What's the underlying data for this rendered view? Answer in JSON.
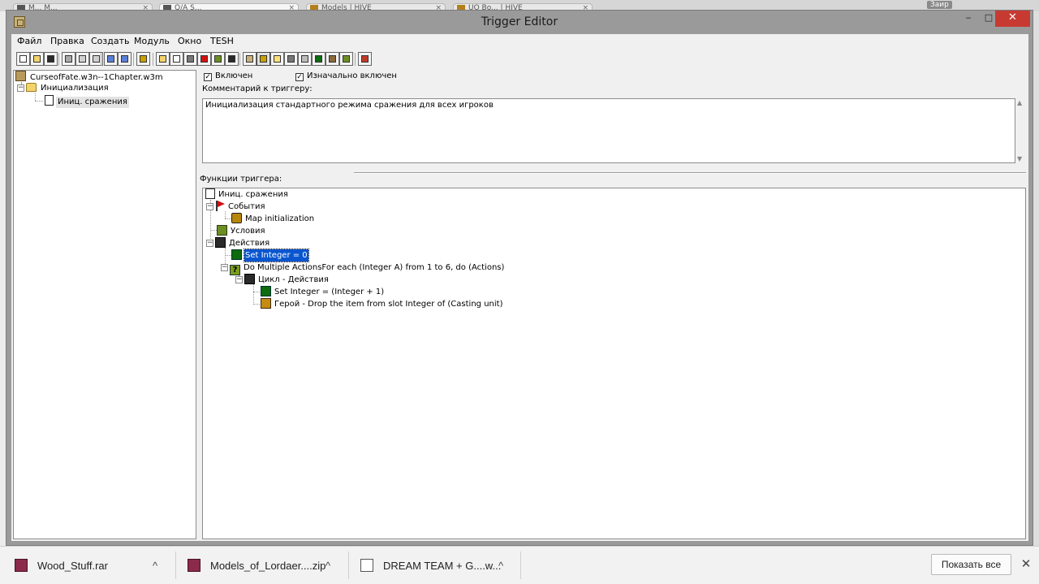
{
  "browser_tabs": [
    {
      "label": "M... M..."
    },
    {
      "label": "Q/A S..."
    },
    {
      "label": "Models | HIVE"
    },
    {
      "label": "UO Bo... | HIVE"
    }
  ],
  "user_chip": "Заир",
  "window": {
    "title": "Trigger Editor",
    "minimize": "‒",
    "maximize": "□",
    "close": "✕"
  },
  "menu": [
    {
      "label": "Файл"
    },
    {
      "label": "Правка"
    },
    {
      "label": "Создать"
    },
    {
      "label": "Модуль"
    },
    {
      "label": "Окно"
    },
    {
      "label": "TESH"
    }
  ],
  "toolbar_icons": [
    "new-icon",
    "open-icon",
    "save-icon",
    "cut-icon",
    "copy-icon",
    "paste-icon",
    "undo-icon",
    "redo-icon",
    "delete-icon",
    "new-category-icon",
    "new-trigger-icon",
    "new-comment-icon",
    "new-event-icon",
    "new-condition-icon",
    "new-action-icon",
    "terrain-editor-icon",
    "trigger-editor-icon",
    "sound-editor-icon",
    "object-editor-icon",
    "campaign-editor-icon",
    "ai-editor-icon",
    "object-manager-icon",
    "import-manager-icon",
    "test-map-icon"
  ],
  "left_tree": {
    "map_file": "CurseofFate.w3n--1Chapter.w3m",
    "category": "Инициализация",
    "trigger": "Иниц. сражения",
    "expander": "−"
  },
  "trigger": {
    "enabled_label": "Включен",
    "enabled": true,
    "initially_on_label": "Изначально включен",
    "initially_on": true,
    "check_mark": "✓",
    "comment_label": "Комментарий к триггеру:",
    "comment": "Инициализация стандартного режима сражения для всех игроков",
    "functions_label": "Функции триггера:"
  },
  "functions_tree": {
    "root": "Иниц. сражения",
    "events_label": "События",
    "event_1": "Map initialization",
    "conditions_label": "Условия",
    "actions_label": "Действия",
    "action_1": "Set Integer = 0",
    "action_2": "Do Multiple ActionsFor each (Integer A) from 1 to 6, do (Actions)",
    "loop_label": "Цикл - Действия",
    "loop_action_1": "Set Integer = (Integer + 1)",
    "loop_action_2": "Герой - Drop the item from slot Integer of (Casting unit)",
    "question_mark": "?"
  },
  "downloads": [
    {
      "name": "Wood_Stuff.rar"
    },
    {
      "name": "Models_of_Lordaer....zip"
    },
    {
      "name": "DREAM TEAM + G....w..."
    }
  ],
  "chevron": "^",
  "show_all": "Показать все",
  "downloads_close": "✕",
  "scroll_up": "▲",
  "scroll_down": "▼"
}
